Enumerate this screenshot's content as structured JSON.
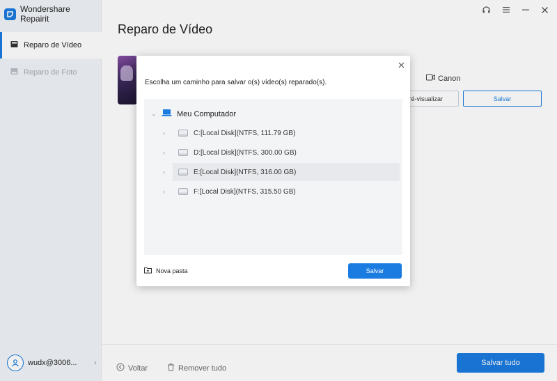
{
  "app": {
    "title": "Wondershare Repairit",
    "accent": "#1a7be0"
  },
  "sidebar": {
    "items": [
      {
        "label": "Reparo de Vídeo",
        "icon": "video-repair-icon",
        "active": true
      },
      {
        "label": "Reparo de Foto",
        "icon": "photo-repair-icon",
        "active": false
      }
    ],
    "user": {
      "name": "wudx@3006..."
    }
  },
  "window_controls": [
    "headset-icon",
    "menu-icon",
    "minimize-icon",
    "close-icon"
  ],
  "main": {
    "title": "Reparo de Vídeo",
    "file": {
      "camera_label": "Canon",
      "preview_label": "ré-visualizar",
      "save_label": "Salvar"
    }
  },
  "bottom_bar": {
    "back_label": "Voltar",
    "remove_all_label": "Remover tudo",
    "save_all_label": "Salvar tudo"
  },
  "dialog": {
    "message": "Escolha um caminho para salvar o(s) vídeo(s) reparado(s).",
    "root_label": "Meu Computador",
    "drives": [
      {
        "label": "C:[Local Disk](NTFS, 111.79  GB)"
      },
      {
        "label": "D:[Local Disk](NTFS, 300.00  GB)"
      },
      {
        "label": "E:[Local Disk](NTFS, 316.00  GB)"
      },
      {
        "label": "F:[Local Disk](NTFS, 315.50  GB)"
      }
    ],
    "hovered_drive_index": 2,
    "new_folder_label": "Nova pasta",
    "save_label": "Salvar"
  }
}
